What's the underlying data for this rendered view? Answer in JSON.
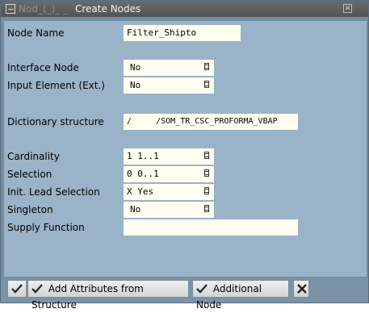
{
  "window": {
    "title_prefix": "Nod_(_)_ _",
    "title": "Create Nodes"
  },
  "form": {
    "node_name": {
      "label": "Node Name",
      "value": "Filter_Shipto"
    },
    "interface_node": {
      "label": "Interface Node",
      "value": "No"
    },
    "input_element": {
      "label": "Input Element (Ext.)",
      "value": "No"
    },
    "dictionary_structure": {
      "label": "Dictionary structure",
      "value": "/     /SOM_TR_CSC_PROFORMA_VBAP"
    },
    "cardinality": {
      "label": "Cardinality",
      "value": "1 1..1"
    },
    "selection": {
      "label": "Selection",
      "value": "0 0..1"
    },
    "init_lead_selection": {
      "label": "Init. Lead Selection",
      "value": "X Yes"
    },
    "singleton": {
      "label": "Singleton",
      "value": "No"
    },
    "supply_function": {
      "label": "Supply Function",
      "value": ""
    }
  },
  "toolbar": {
    "add_attributes_label": "Add Attributes from Structure",
    "additional_node_label": "Additional Node"
  },
  "colors": {
    "panel": "#9ab3c8",
    "field_bg": "#fffef0",
    "titlebar": "#5a5a5a"
  }
}
